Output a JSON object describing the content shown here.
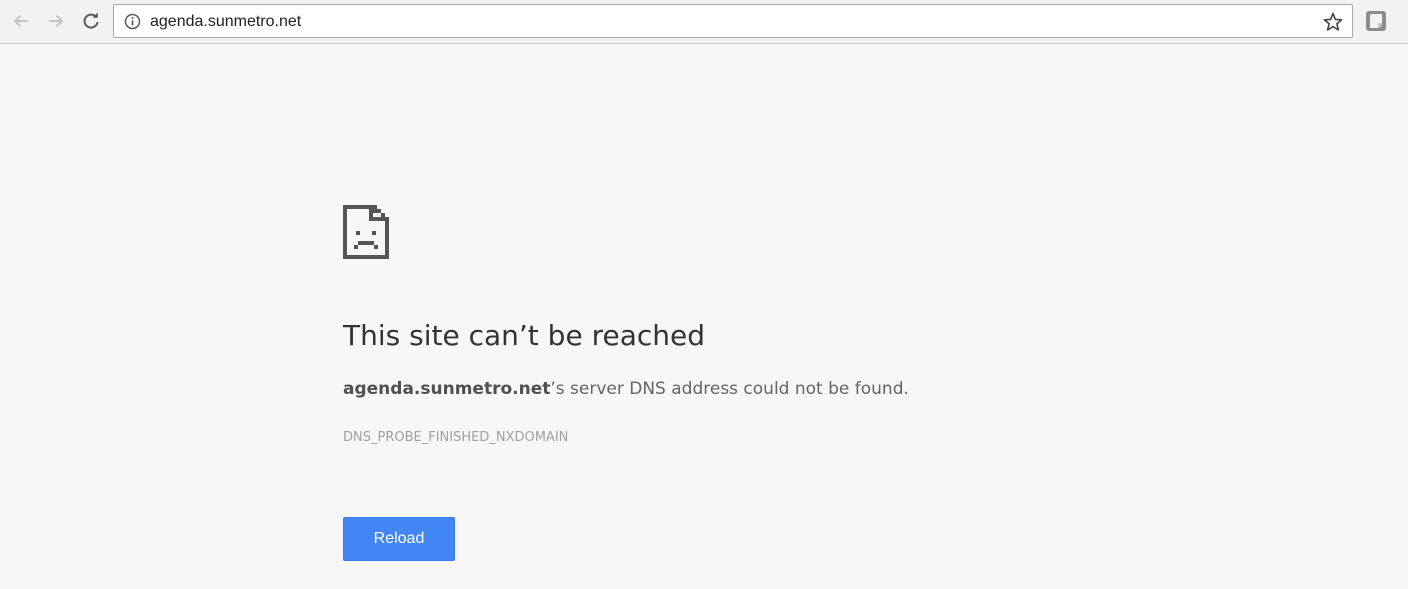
{
  "browser": {
    "url": "agenda.sunmetro.net",
    "icons": {
      "back": "arrow-left-icon",
      "forward": "arrow-right-icon",
      "reload": "reload-icon",
      "site_info": "info-circle-icon",
      "bookmark": "star-icon",
      "extension": "extension-icon"
    }
  },
  "error_page": {
    "icon": "sad-page-icon",
    "title": "This site can’t be reached",
    "host": "agenda.sunmetro.net",
    "message_suffix": "’s server DNS address could not be found.",
    "error_code": "DNS_PROBE_FINISHED_NXDOMAIN",
    "reload_label": "Reload",
    "reload_color": "#4285f4"
  }
}
